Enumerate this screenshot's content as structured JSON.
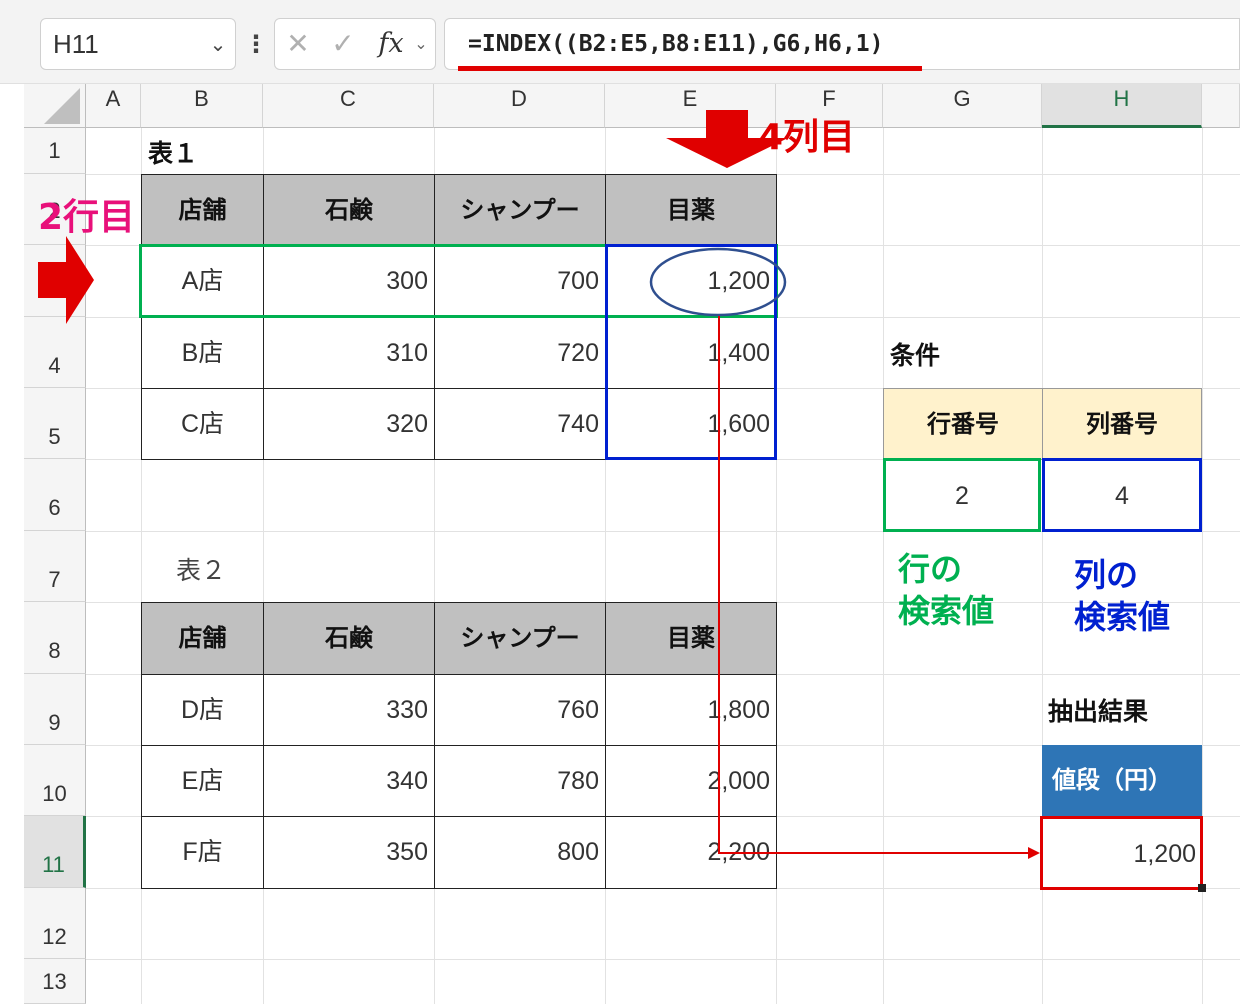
{
  "formula_bar": {
    "name_box": "H11",
    "formula": "=INDEX((B2:E5,B8:E11),G6,H6,1)",
    "cancel_icon": "close-icon",
    "enter_icon": "check-icon",
    "fx_label": "fx"
  },
  "columns": [
    "A",
    "B",
    "C",
    "D",
    "E",
    "F",
    "G",
    "H"
  ],
  "rows": [
    "1",
    "2",
    "3",
    "4",
    "5",
    "6",
    "7",
    "8",
    "9",
    "10",
    "11",
    "12",
    "13"
  ],
  "table1": {
    "title": "表１",
    "headers": [
      "店舗",
      "石鹸",
      "シャンプー",
      "目薬"
    ],
    "rows": [
      [
        "A店",
        "300",
        "700",
        "1,200"
      ],
      [
        "B店",
        "310",
        "720",
        "1,400"
      ],
      [
        "C店",
        "320",
        "740",
        "1,600"
      ]
    ]
  },
  "table2": {
    "title": "表２",
    "headers": [
      "店舗",
      "石鹸",
      "シャンプー",
      "目薬"
    ],
    "rows": [
      [
        "D店",
        "330",
        "760",
        "1,800"
      ],
      [
        "E店",
        "340",
        "780",
        "2,000"
      ],
      [
        "F店",
        "350",
        "800",
        "2,200"
      ]
    ]
  },
  "conditions": {
    "title": "条件",
    "row_header": "行番号",
    "col_header": "列番号",
    "row_value": "2",
    "col_value": "4"
  },
  "result": {
    "title": "抽出結果",
    "header": "値段（円）",
    "value": "1,200"
  },
  "annotations": {
    "row_label": "2行目",
    "col_label": "4列目",
    "row_lookup_1": "行の",
    "row_lookup_2": "検索値",
    "col_lookup_1": "列の",
    "col_lookup_2": "検索値"
  },
  "colors": {
    "header_fill": "#c0c0c0",
    "condition_header_fill": "#fff2cc",
    "result_header_fill": "#2e75b6",
    "arrow_red": "#e00000",
    "green": "#00b050",
    "blue": "#0020d0",
    "pink": "#e8107a",
    "selected_green": "#217346"
  }
}
